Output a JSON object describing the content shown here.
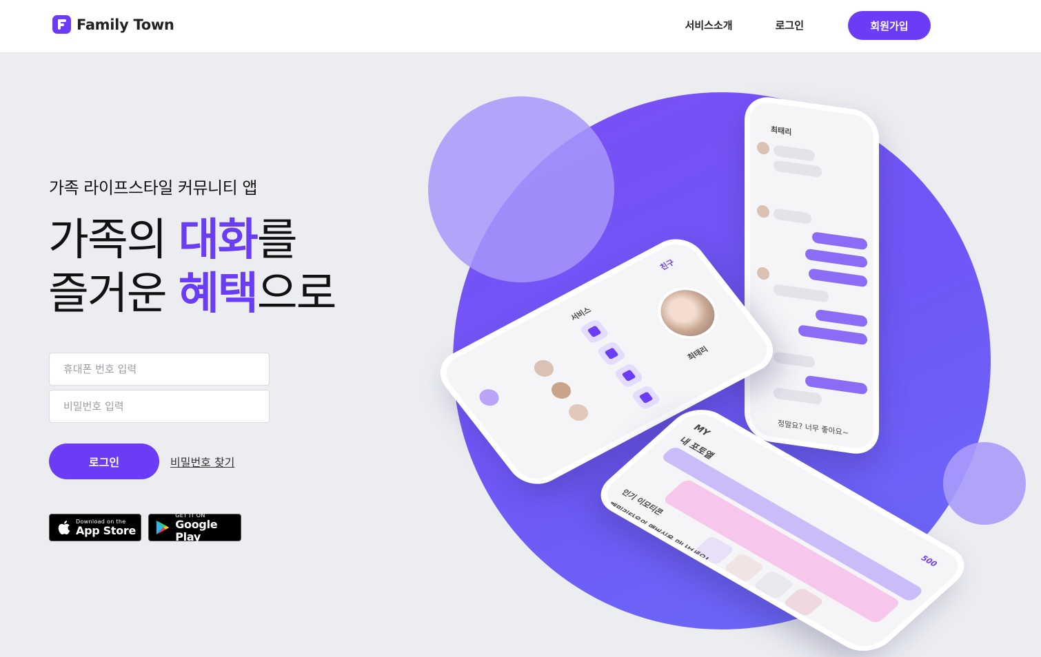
{
  "header": {
    "brand": "Family Town",
    "nav": {
      "service_intro": "서비스소개",
      "login": "로그인",
      "signup": "회원가입"
    }
  },
  "hero": {
    "subtitle": "가족 라이프스타일 커뮤니티 앱",
    "headline_line1_pre": "가족의 ",
    "headline_line1_highlight": "대화",
    "headline_line1_post": "를",
    "headline_line2_pre": "즐거운 ",
    "headline_line2_highlight": "혜택",
    "headline_line2_post": "으로"
  },
  "form": {
    "phone_placeholder": "휴대폰 번호 입력",
    "password_placeholder": "비밀번호 입력",
    "login_button": "로그인",
    "find_password": "비밀번호 찾기"
  },
  "stores": {
    "appstore_small": "Download on the",
    "appstore_big": "App Store",
    "googleplay_small": "GET IT ON",
    "googleplay_big": "Google Play"
  },
  "mockup": {
    "chat_contact": "최태리",
    "chat_last_message": "정말요? 너무 좋아요~",
    "profile_name": "최태리",
    "profile_tab": "친구",
    "profile_services": "서비스",
    "my_title": "MY",
    "my_points": "500",
    "my_album": "내 포토앨",
    "my_popular": "인기 이모티콘",
    "my_family_meet": "패밀리타운의 맴버십을 만나보세요!"
  },
  "colors": {
    "accent": "#6b3cf6",
    "background": "#ebedf1",
    "circle": "#7a4ff6"
  }
}
